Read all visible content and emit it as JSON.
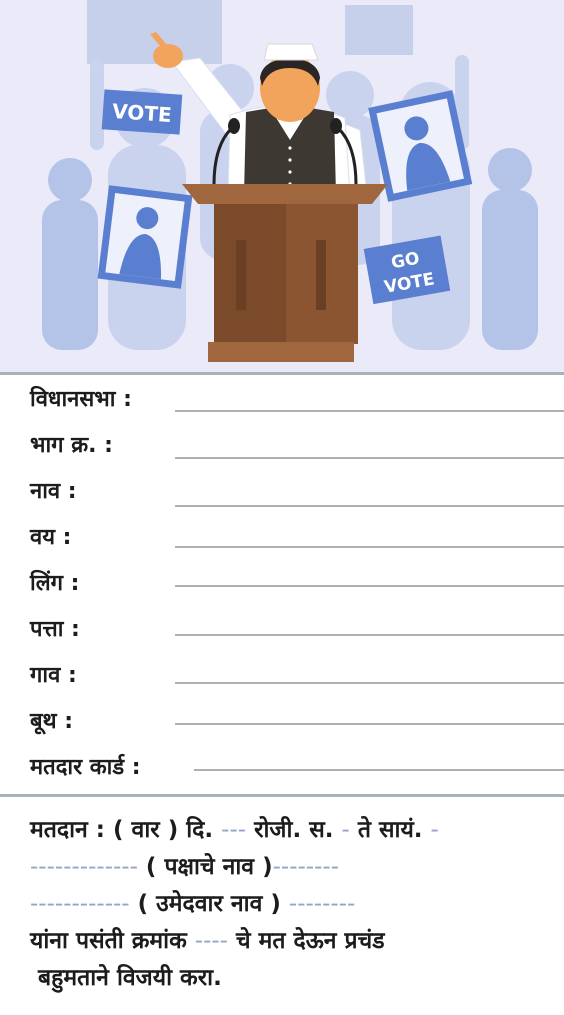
{
  "banner": {
    "vote_sign": "VOTE",
    "go_vote_sign_line1": "GO",
    "go_vote_sign_line2": "VOTE",
    "colors": {
      "background": "#ebeaf8",
      "accent": "#5b7fd0",
      "podium": "#7a4a2a"
    }
  },
  "form": {
    "fields": [
      {
        "label": "विधानसभा :"
      },
      {
        "label": "भाग क्र. :"
      },
      {
        "label": "नाव  :"
      },
      {
        "label": "वय  :"
      },
      {
        "label": "लिंग  :"
      },
      {
        "label": "पत्ता  :"
      },
      {
        "label": "गाव  :"
      },
      {
        "label": "बूथ   :"
      },
      {
        "label": "मतदार कार्ड :"
      }
    ]
  },
  "appeal": {
    "line1_a": "मतदान : ( वार ) दि.",
    "blank1": "---",
    "line1_b": "रोजी. स.",
    "blank2": "-",
    "line1_c": "ते सायं.",
    "blank3": "-",
    "blank4": "-------------",
    "line2_a": "( पक्षाचे नाव )",
    "blank5": "--------",
    "blank6": "------------",
    "line3_a": "( उमेदवार नाव )",
    "blank7": "--------",
    "line4_a": "यांना पसंती क्रमांक",
    "blank8": "----",
    "line4_b": "चे मत देऊन प्रचंड",
    "line5": "बहुमताने विजयी करा."
  }
}
